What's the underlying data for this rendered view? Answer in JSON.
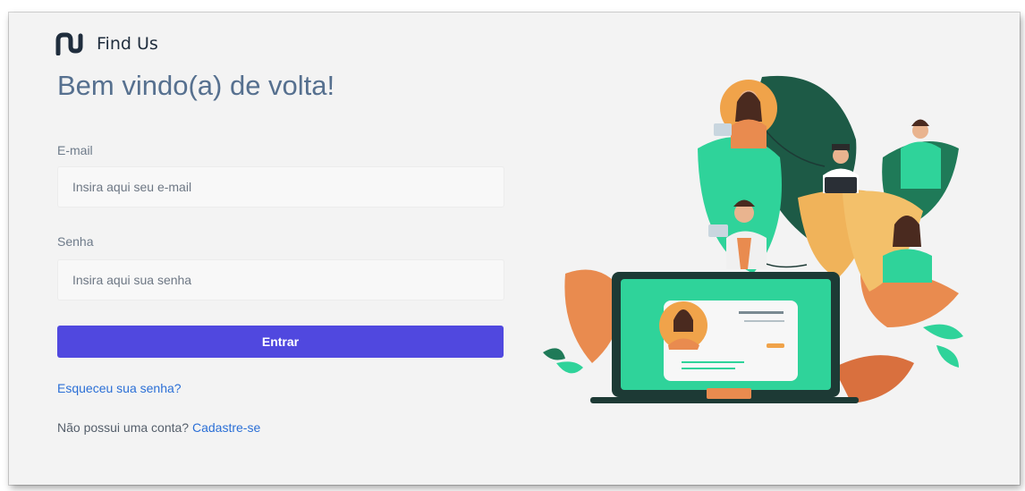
{
  "brand": {
    "name": "Find Us",
    "logo_icon": "find-us-logo-icon"
  },
  "heading": "Bem vindo(a) de volta!",
  "form": {
    "email_label": "E-mail",
    "email_placeholder": "Insira aqui seu e-mail",
    "email_value": "",
    "password_label": "Senha",
    "password_placeholder": "Insira aqui sua senha",
    "password_value": "",
    "submit_label": "Entrar"
  },
  "links": {
    "forgot_password": "Esqueceu sua senha?",
    "no_account_text": "Não possui uma conta?",
    "signup": "Cadastre-se"
  },
  "colors": {
    "primary_button": "#5048df",
    "link": "#2b6fd6",
    "heading": "#56708f",
    "illustration_green": "#2fd39a",
    "illustration_orange": "#f0a34a",
    "illustration_dark": "#1d5a46"
  },
  "illustration": {
    "icon": "people-network-laptop-illustration"
  }
}
